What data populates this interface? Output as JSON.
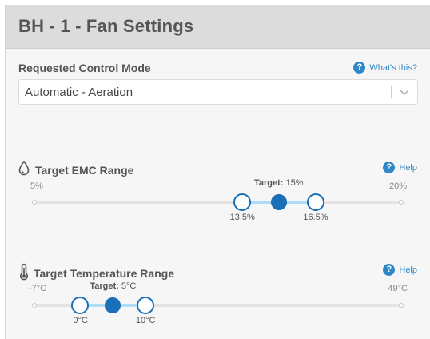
{
  "header": {
    "title": "BH - 1 - Fan Settings"
  },
  "control_mode": {
    "label": "Requested Control Mode",
    "help_icon": "question-circle-icon",
    "help_text": "What's this?",
    "selected_value": "Automatic - Aeration",
    "chevron_icon": "chevron-down-icon"
  },
  "emc": {
    "label": "Target EMC Range",
    "icon": "water-drop-icon",
    "help_text": "Help",
    "min_label": "5%",
    "max_label": "20%",
    "target_prefix": "Target:",
    "target_value": "15%",
    "low_label": "13.5%",
    "high_label": "16.5%",
    "scale_min": 5,
    "scale_max": 20,
    "low": 13.5,
    "target": 15,
    "high": 16.5
  },
  "temperature": {
    "label": "Target Temperature Range",
    "icon": "thermometer-icon",
    "help_text": "Help",
    "min_label": "-7°C",
    "max_label": "49°C",
    "target_prefix": "Target:",
    "target_value": "5°C",
    "low_label": "0°C",
    "high_label": "10°C",
    "scale_min": -7,
    "scale_max": 49,
    "low": 0,
    "target": 5,
    "high": 10
  },
  "colors": {
    "accent": "#1a6fb8",
    "help_blue": "#2f87c8",
    "range_fill": "#aedcf5",
    "header_bg": "#dcdcdc"
  }
}
